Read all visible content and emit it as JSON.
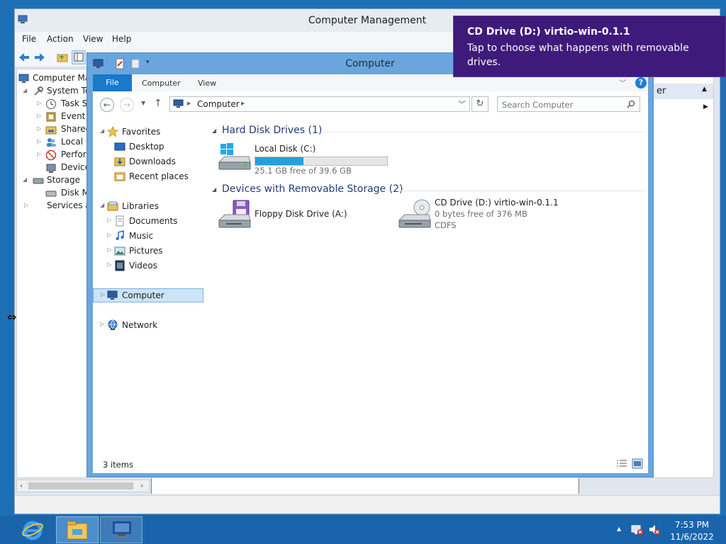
{
  "computer_management": {
    "title": "Computer Management",
    "menu": [
      "File",
      "Action",
      "View",
      "Help"
    ],
    "tree": [
      {
        "label": "Computer Ma",
        "icon": "computer-management-icon"
      },
      {
        "label": "System To",
        "icon": "system-tools-icon"
      },
      {
        "label": "Task Sc",
        "icon": "clock-icon"
      },
      {
        "label": "Event V",
        "icon": "event-viewer-icon"
      },
      {
        "label": "Shared",
        "icon": "shared-folders-icon"
      },
      {
        "label": "Local U",
        "icon": "users-icon"
      },
      {
        "label": "Perform",
        "icon": "performance-icon"
      },
      {
        "label": "Device",
        "icon": "device-manager-icon"
      },
      {
        "label": "Storage",
        "icon": "storage-icon"
      },
      {
        "label": "Disk M",
        "icon": "disk-management-icon"
      },
      {
        "label": "Services an",
        "icon": "services-icon"
      }
    ],
    "actions_header_fragment": "er"
  },
  "explorer": {
    "title": "Computer",
    "ribbon_tabs": [
      "File",
      "Computer",
      "View"
    ],
    "address": "Computer",
    "search_placeholder": "Search Computer",
    "help_label": "?",
    "nav": {
      "favorites": "Favorites",
      "desktop": "Desktop",
      "downloads": "Downloads",
      "recent_places": "Recent places",
      "libraries": "Libraries",
      "documents": "Documents",
      "music": "Music",
      "pictures": "Pictures",
      "videos": "Videos",
      "computer": "Computer",
      "network": "Network"
    },
    "groups": {
      "hard_disk": "Hard Disk Drives (1)",
      "removable": "Devices with Removable Storage (2)"
    },
    "drives": {
      "local": {
        "name": "Local Disk (C:)",
        "free": "25.1 GB free of 39.6 GB",
        "used_fraction": 0.366
      },
      "floppy": {
        "name": "Floppy Disk Drive (A:)"
      },
      "cd": {
        "name": "CD Drive (D:) virtio-win-0.1.1",
        "free": "0 bytes free of 376 MB",
        "fs": "CDFS"
      }
    },
    "status": "3 items"
  },
  "toast": {
    "title": "CD Drive (D:) virtio-win-0.1.1",
    "body": "Tap to choose what happens with removable drives."
  },
  "taskbar": {
    "time": "7:53 PM",
    "date": "11/6/2022",
    "apps": [
      "internet-explorer-icon",
      "file-explorer-icon",
      "computer-management-icon"
    ]
  },
  "colors": {
    "accent": "#1979ca",
    "toast_bg": "#3e1a7a",
    "taskbar_bg": "#1a64ac",
    "capacity_fill": "#26a0da"
  }
}
